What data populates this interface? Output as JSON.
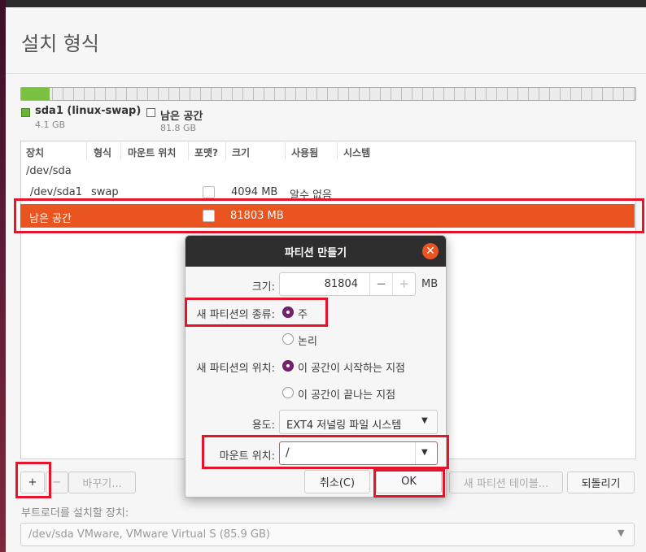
{
  "window": {
    "title": "설치 형식"
  },
  "legend": [
    {
      "name": "sda1 (linux-swap)",
      "size": "4.1 GB",
      "color": "#7ac142"
    },
    {
      "name": "남은 공간",
      "size": "81.8 GB",
      "color": "#ffffff"
    }
  ],
  "table": {
    "headers": [
      "장치",
      "형식",
      "마운트 위치",
      "포맷?",
      "크기",
      "사용됨",
      "시스템"
    ],
    "rows": [
      {
        "device": "/dev/sda"
      },
      {
        "device": "/dev/sda1",
        "type": "swap",
        "size": "4094 MB",
        "used": "알수 없음"
      },
      {
        "device": "남은 공간",
        "size": "81803 MB",
        "selected": true
      }
    ]
  },
  "toolbar": {
    "add": "+",
    "remove": "−",
    "change": "바꾸기...",
    "new_table": "새 파티션 테이블...",
    "revert": "되돌리기"
  },
  "bootloader": {
    "label": "부트로더를 설치할 장치:",
    "value": "/dev/sda   VMware, VMware Virtual S (85.9 GB)"
  },
  "dialog": {
    "title": "파티션 만들기",
    "size_label": "크기:",
    "size_value": "81804",
    "size_unit": "MB",
    "minus": "−",
    "plus": "+",
    "type_label": "새 파티션의 종류:",
    "type_primary": "주",
    "type_logical": "논리",
    "location_label": "새 파티션의 위치:",
    "location_start": "이 공간이 시작하는 지점",
    "location_end": "이 공간이 끝나는 지점",
    "use_label": "용도:",
    "use_value": "EXT4 저널링 파일 시스템",
    "mount_label": "마운트 위치:",
    "mount_value": "/",
    "cancel": "취소(C)",
    "ok": "OK"
  },
  "colors": {
    "accent": "#e95420",
    "radio": "#77216f",
    "highlight_box": "#e5142b"
  }
}
